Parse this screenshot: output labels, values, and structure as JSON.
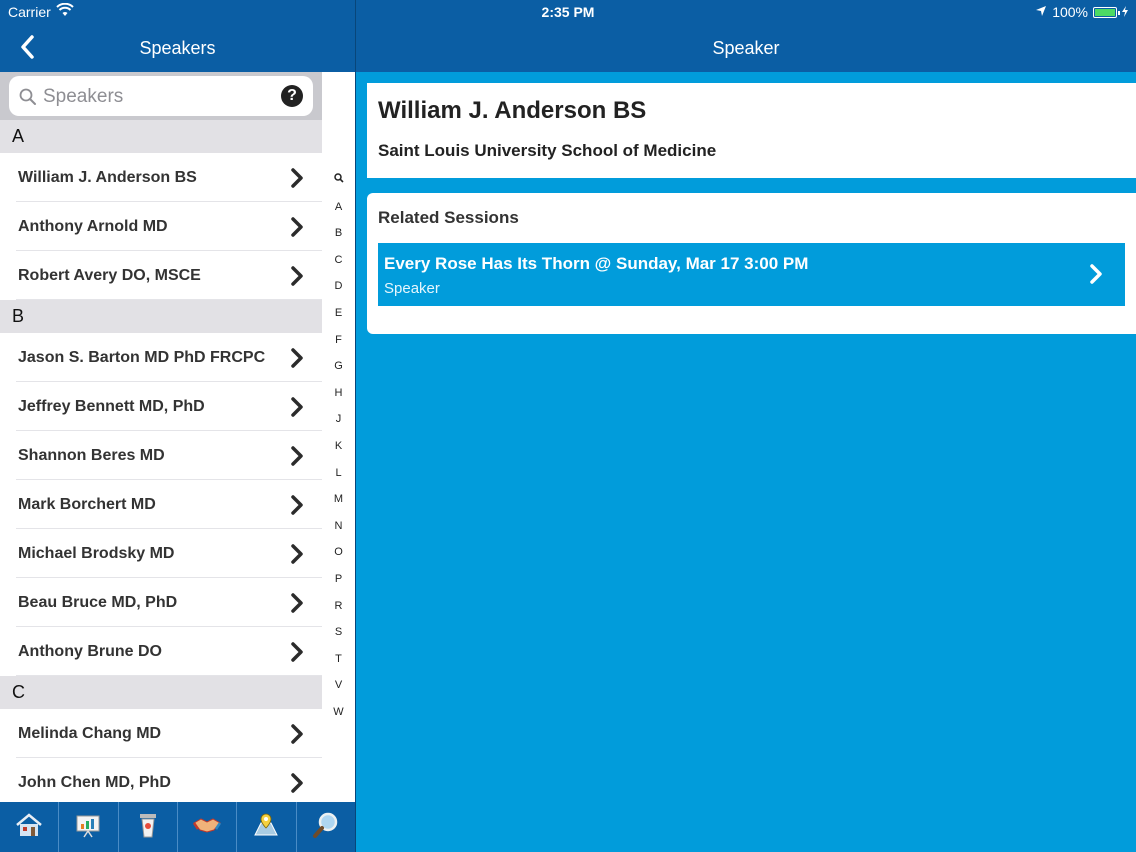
{
  "status": {
    "carrier": "Carrier",
    "time": "2:35 PM",
    "battery": "100%",
    "battery_fill": 1.0
  },
  "master": {
    "title": "Speakers",
    "search": {
      "placeholder": "Speakers"
    },
    "sections": [
      {
        "letter": "A",
        "speakers": [
          "William J. Anderson BS",
          "Anthony Arnold MD",
          "Robert Avery DO, MSCE"
        ]
      },
      {
        "letter": "B",
        "speakers": [
          "Jason S. Barton MD PhD FRCPC",
          "Jeffrey Bennett MD, PhD",
          "Shannon Beres MD",
          "Mark Borchert MD",
          "Michael Brodsky MD",
          "Beau Bruce MD, PhD",
          "Anthony Brune DO"
        ]
      },
      {
        "letter": "C",
        "speakers": [
          "Melinda Chang MD",
          "John Chen MD, PhD"
        ]
      }
    ],
    "index": [
      "A",
      "B",
      "C",
      "D",
      "E",
      "F",
      "G",
      "H",
      "J",
      "K",
      "L",
      "M",
      "N",
      "O",
      "P",
      "R",
      "S",
      "T",
      "V",
      "W"
    ]
  },
  "tabs": [
    {
      "icon": "home-icon"
    },
    {
      "icon": "presentation-icon"
    },
    {
      "icon": "podium-icon"
    },
    {
      "icon": "handshake-icon"
    },
    {
      "icon": "map-icon"
    },
    {
      "icon": "search-icon"
    }
  ],
  "detail": {
    "title": "Speaker",
    "speaker_name": "William J. Anderson BS",
    "organization": "Saint Louis University School of Medicine",
    "related_heading": "Related Sessions",
    "sessions": [
      {
        "title": "Every Rose Has Its Thorn @ Sunday, Mar 17 3:00 PM",
        "role": "Speaker"
      }
    ]
  },
  "colors": {
    "nav": "#0b5ea4",
    "accent": "#019cdb",
    "section": "#e2e1e5"
  }
}
